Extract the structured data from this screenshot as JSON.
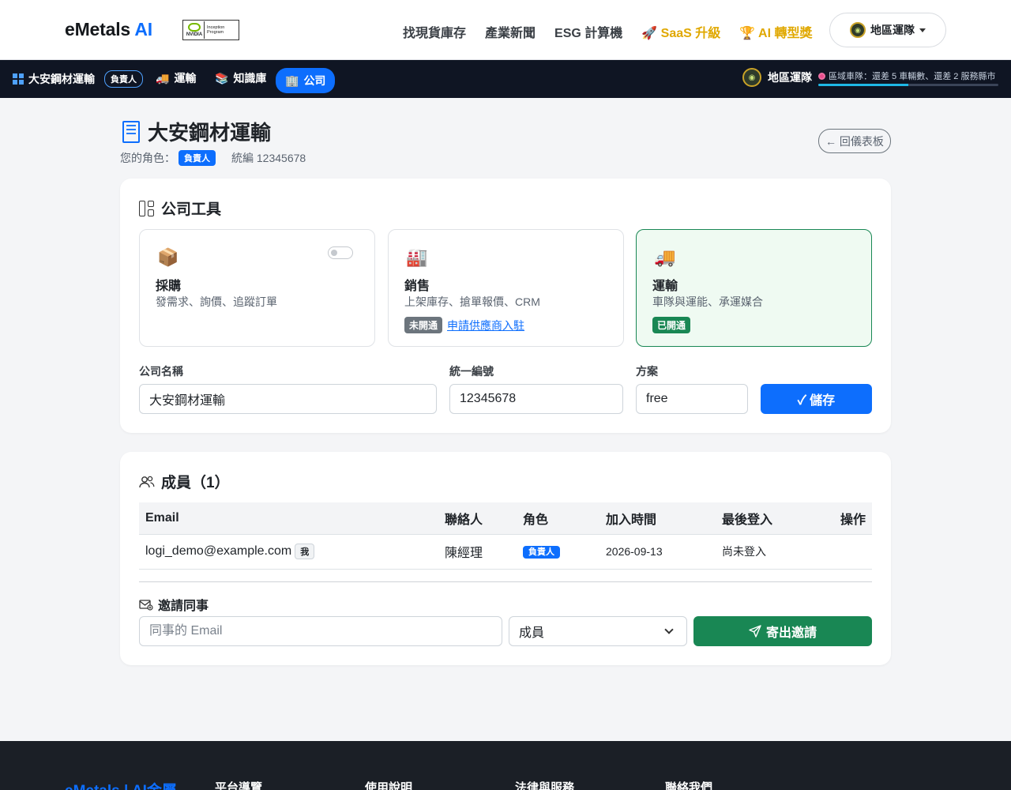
{
  "brand": {
    "name": "eMetals",
    "ai": "AI",
    "badge_word": "NVIDIA",
    "badge_text": "Inception Program"
  },
  "top_nav": {
    "links": [
      "找現貨庫存",
      "產業新聞",
      "ESG 計算機"
    ],
    "saas": "🚀 SaaS 升級",
    "ai_award": "🏆 AI 轉型獎",
    "region_button": "地區運隊"
  },
  "sub_nav": {
    "company": "大安鋼材運輸",
    "role_badge": "負責人",
    "tabs": [
      {
        "icon": "🚚",
        "label": "運輸"
      },
      {
        "icon": "📚",
        "label": "知識庫"
      },
      {
        "icon": "🏢",
        "label": "公司"
      }
    ],
    "region_label": "地區運隊",
    "progress_text": "區域車隊：還差 5 車輛數、還差 2 服務縣市",
    "progress_pct": 50
  },
  "header": {
    "title": "大安鋼材運輸",
    "role_prefix": "您的角色：",
    "role": "負責人",
    "tax_id_text": "統編 12345678",
    "back_button": "← 回儀表板"
  },
  "tools": {
    "heading": "公司工具",
    "items": [
      {
        "emoji": "📦",
        "name": "採購",
        "desc": "發需求、詢價、追蹤訂單"
      },
      {
        "emoji": "🏭",
        "name": "銷售",
        "desc": "上架庫存、搶單報價、CRM",
        "status": "未開通",
        "link": "申請供應商入駐"
      },
      {
        "emoji": "🚚",
        "name": "運輸",
        "desc": "車隊與運能、承運媒合",
        "status": "已開通"
      }
    ]
  },
  "form": {
    "company_name_label": "公司名稱",
    "company_name_value": "大安鋼材運輸",
    "tax_id_label": "統一編號",
    "tax_id_value": "12345678",
    "plan_label": "方案",
    "plan_value": "free",
    "save_button": "✓ 儲存"
  },
  "members": {
    "heading": "成員（1）",
    "columns": [
      "Email",
      "聯絡人",
      "角色",
      "加入時間",
      "最後登入",
      "操作"
    ],
    "rows": [
      {
        "email": "logi_demo@example.com",
        "me": "我",
        "contact": "陳經理",
        "role": "負責人",
        "joined": "2026-09-13",
        "last_login": "尚未登入"
      }
    ]
  },
  "invite": {
    "heading": "邀請同事",
    "email_placeholder": "同事的 Email",
    "role_value": "成員",
    "send_button": "寄出邀請"
  },
  "footer": {
    "brand": "eMetals | AI金屬",
    "columns": [
      "平台導覽",
      "使用說明",
      "法律與服務",
      "聯絡我們"
    ]
  }
}
